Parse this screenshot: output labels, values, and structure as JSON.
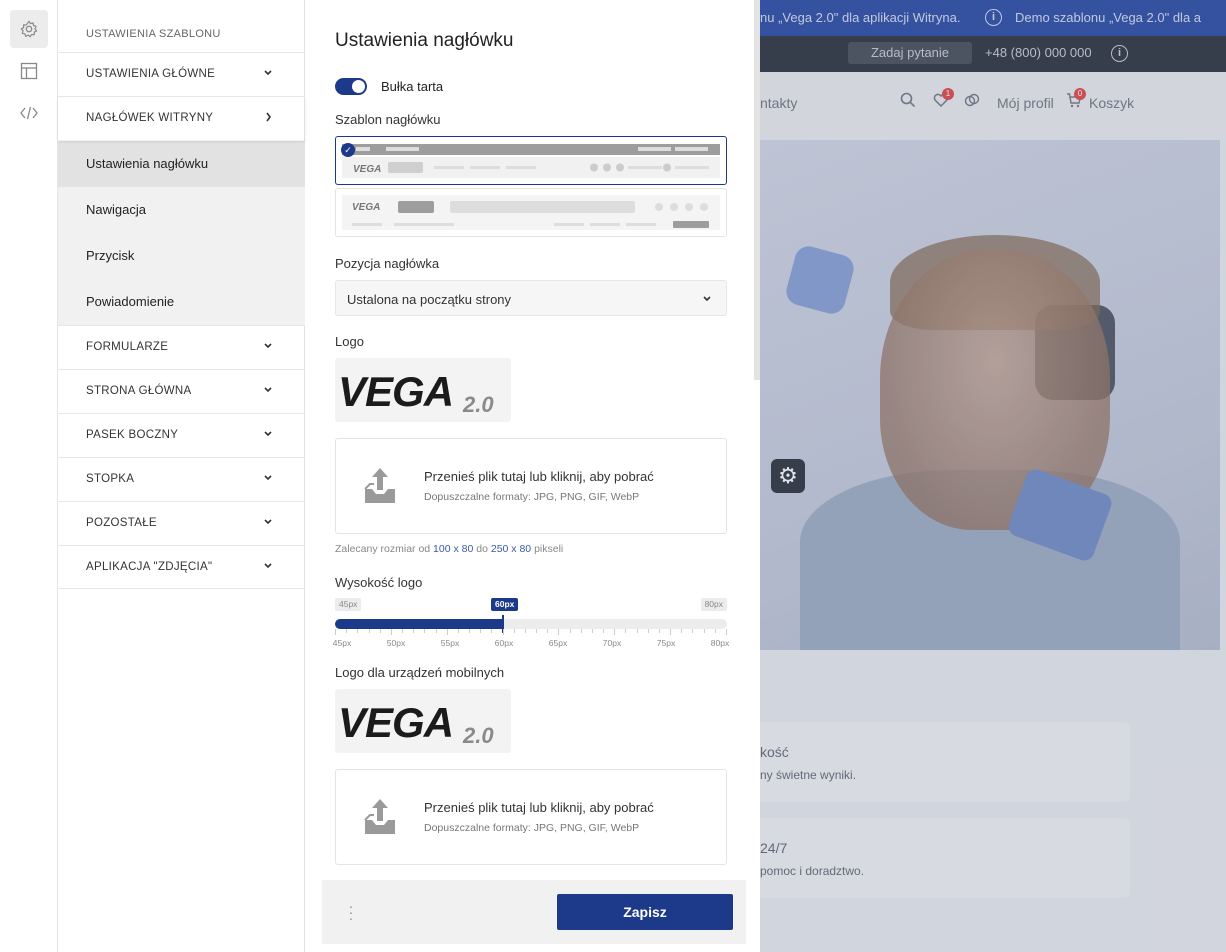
{
  "rail": {
    "items": [
      "gear-icon",
      "layout-icon",
      "code-icon"
    ]
  },
  "sidebar": {
    "heading": "USTAWIENIA SZABLONU",
    "sections": [
      {
        "label": "USTAWIENIA GŁÓWNE"
      },
      {
        "label": "NAGŁÓWEK WITRYNY"
      },
      {
        "label": "FORMULARZE"
      },
      {
        "label": "STRONA GŁÓWNA"
      },
      {
        "label": "PASEK BOCZNY"
      },
      {
        "label": "STOPKA"
      },
      {
        "label": "POZOSTAŁE"
      },
      {
        "label": "APLIKACJA \"ZDJĘCIA\""
      }
    ],
    "subitems": [
      {
        "label": "Ustawienia nagłówku",
        "active": true
      },
      {
        "label": "Nawigacja"
      },
      {
        "label": "Przycisk"
      },
      {
        "label": "Powiadomienie"
      }
    ]
  },
  "panel": {
    "title": "Ustawienia nagłówku",
    "breadcrumbs_toggle": {
      "label": "Bułka tarta",
      "on": true
    },
    "template_label": "Szablon nagłówku",
    "template_logo_text": "VEGA",
    "position_label": "Pozycja nagłówka",
    "position_value": "Ustalona na początku strony",
    "logo_label": "Logo",
    "logo_text": "VEGA",
    "logo_suffix": "2.0",
    "upload_message": "Przenieś plik tutaj lub kliknij, aby pobrać",
    "upload_formats": "Dopuszczalne formaty: JPG, PNG, GIF, WebP",
    "size_hint": {
      "prefix": "Zalecany rozmiar od ",
      "min": "100 x 80",
      "mid": " do ",
      "max": "250 x 80",
      "suffix": " pikseli"
    },
    "logo_height": {
      "label": "Wysokość logo",
      "min_label": "45px",
      "max_label": "80px",
      "current_label": "60px",
      "value": 60,
      "min": 45,
      "max": 80,
      "tick_labels": [
        "45px",
        "50px",
        "55px",
        "60px",
        "65px",
        "70px",
        "75px",
        "80px"
      ]
    },
    "mobile_logo_label": "Logo dla urządzeń mobilnych",
    "save_label": "Zapisz"
  },
  "site": {
    "topbar_text": "nu „Vega 2.0\" dla aplikacji Witryna.",
    "topbar_text2": "Demo szablonu „Vega 2.0\" dla a",
    "ask_label": "Zadaj pytanie",
    "phone": "+48 (800) 000 000",
    "nav_contacts": "ntakty",
    "profile": "Mój profil",
    "cart": "Koszyk",
    "fav_count": "1",
    "cart_count": "0",
    "card1_title": "kość",
    "card1_text": "ny świetne wyniki.",
    "card2_title": "24/7",
    "card2_text": "pomoc i doradztwo."
  },
  "colors": {
    "accent": "#1d3a8a",
    "topbar": "#3b5bb0"
  }
}
